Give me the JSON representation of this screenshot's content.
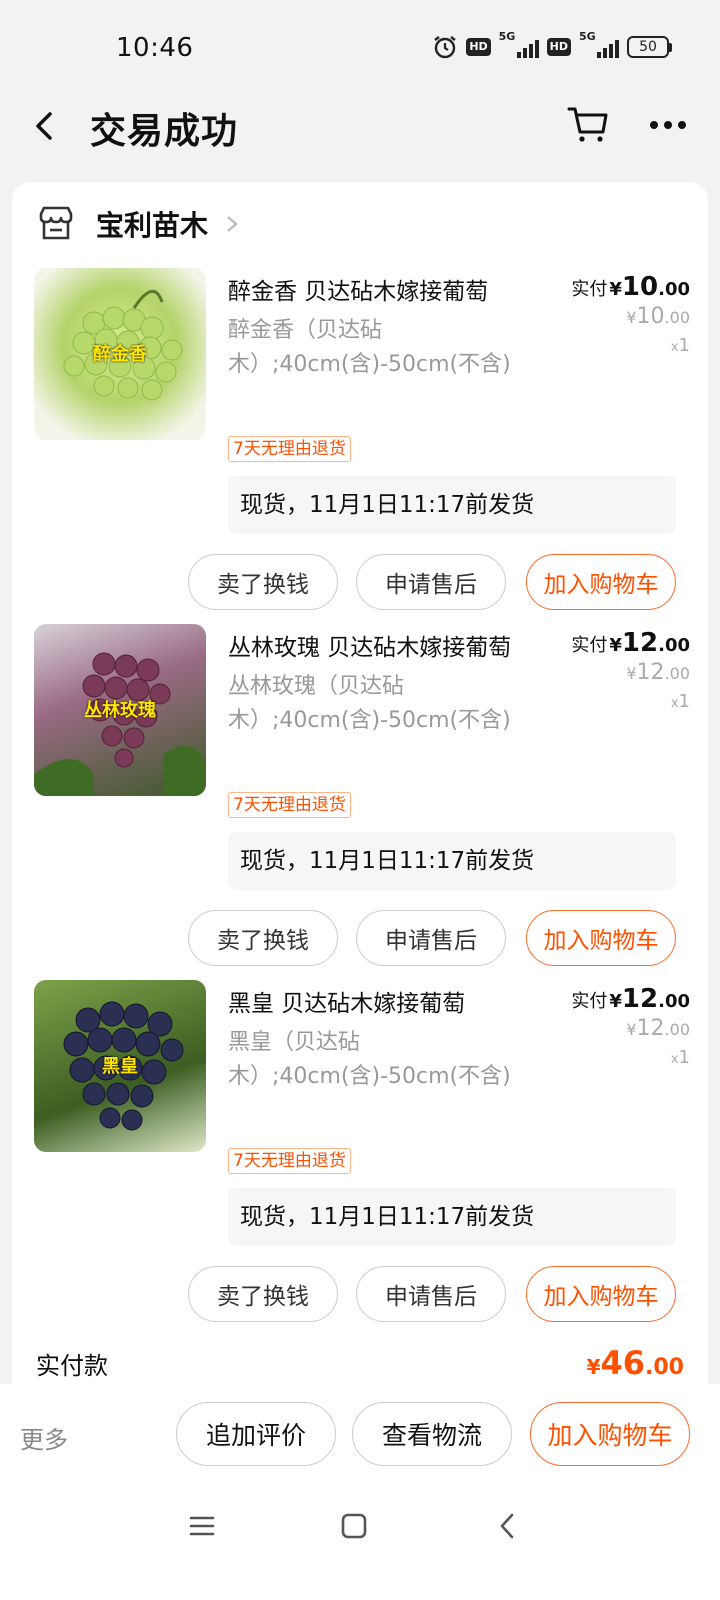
{
  "status_bar": {
    "time": "10:46",
    "battery": "50"
  },
  "header": {
    "title": "交易成功"
  },
  "shop": {
    "name": "宝利苗木"
  },
  "items": [
    {
      "title": "醉金香 贝达砧木嫁接葡萄",
      "spec": "醉金香（贝达砧木）;40cm(含)-50cm(不含)",
      "tag": "7天无理由退货",
      "paid_label": "实付",
      "paid_int": "10",
      "paid_dec": ".00",
      "orig_int": "10",
      "orig_dec": ".00",
      "qty": "1",
      "shipping": "现货，11月1日11:17前发货",
      "thumb_text": "醉金香",
      "thumb_color": "#c8e27a",
      "btn_sell": "卖了换钱",
      "btn_after": "申请售后",
      "btn_cart": "加入购物车"
    },
    {
      "title": "丛林玫瑰 贝达砧木嫁接葡萄",
      "spec": "丛林玫瑰（贝达砧木）;40cm(含)-50cm(不含)",
      "tag": "7天无理由退货",
      "paid_label": "实付",
      "paid_int": "12",
      "paid_dec": ".00",
      "orig_int": "12",
      "orig_dec": ".00",
      "qty": "1",
      "shipping": "现货，11月1日11:17前发货",
      "thumb_text": "丛林玫瑰",
      "thumb_color": "#7a3a55",
      "btn_sell": "卖了换钱",
      "btn_after": "申请售后",
      "btn_cart": "加入购物车"
    },
    {
      "title": "黑皇 贝达砧木嫁接葡萄",
      "spec": "黑皇（贝达砧木）;40cm(含)-50cm(不含)",
      "tag": "7天无理由退货",
      "paid_label": "实付",
      "paid_int": "12",
      "paid_dec": ".00",
      "orig_int": "12",
      "orig_dec": ".00",
      "qty": "1",
      "shipping": "现货，11月1日11:17前发货",
      "thumb_text": "黑皇",
      "thumb_color": "#2a2c4a",
      "btn_sell": "卖了换钱",
      "btn_after": "申请售后",
      "btn_cart": "加入购物车"
    }
  ],
  "total": {
    "label": "实付款",
    "currency": "¥",
    "int": "46",
    "dec": ".00"
  },
  "bottom_bar": {
    "more": "更多",
    "btn_review": "追加评价",
    "btn_logistics": "查看物流",
    "btn_cart": "加入购物车"
  },
  "colors": {
    "accent": "#ff5000",
    "background": "#f2f2f2"
  }
}
